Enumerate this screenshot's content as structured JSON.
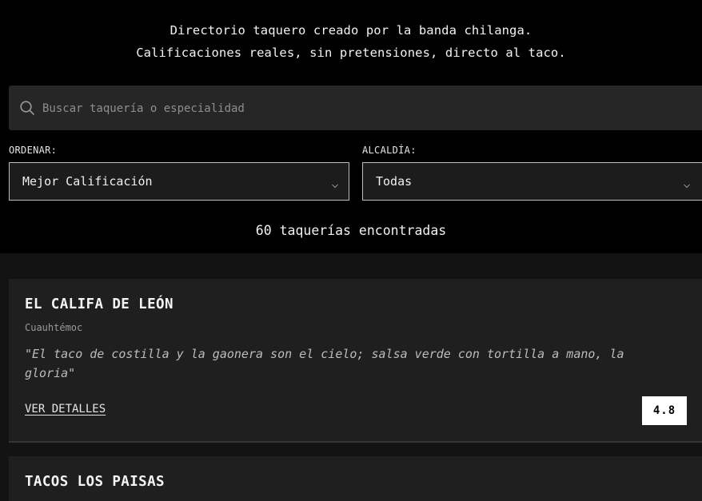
{
  "header": {
    "tagline_line1": "Directorio taquero creado por la banda chilanga.",
    "tagline_line2": "Calificaciones reales, sin pretensiones, directo al taco."
  },
  "search": {
    "placeholder": "Buscar taquería o especialidad",
    "value": "",
    "icon": "search-icon"
  },
  "filters": {
    "sort": {
      "label": "ORDENAR:",
      "selected": "Mejor Calificación"
    },
    "borough": {
      "label": "ALCALDÍA:",
      "selected": "Todas"
    }
  },
  "results": {
    "count_text": "60 taquerías encontradas"
  },
  "taquerias": [
    {
      "name": "EL CALIFA DE LEÓN",
      "borough": "Cuauhtémoc",
      "quote": "\"El taco de costilla y la gaonera son el cielo; salsa verde con tortilla a mano, la gloria\"",
      "link_label": "VER DETALLES",
      "rating": "4.8"
    },
    {
      "name": "TACOS LOS PAISAS"
    }
  ],
  "colors": {
    "background": "#000000",
    "surface": "#262626",
    "card": "#1f1f1f",
    "rating_badge": "#ffffff"
  }
}
